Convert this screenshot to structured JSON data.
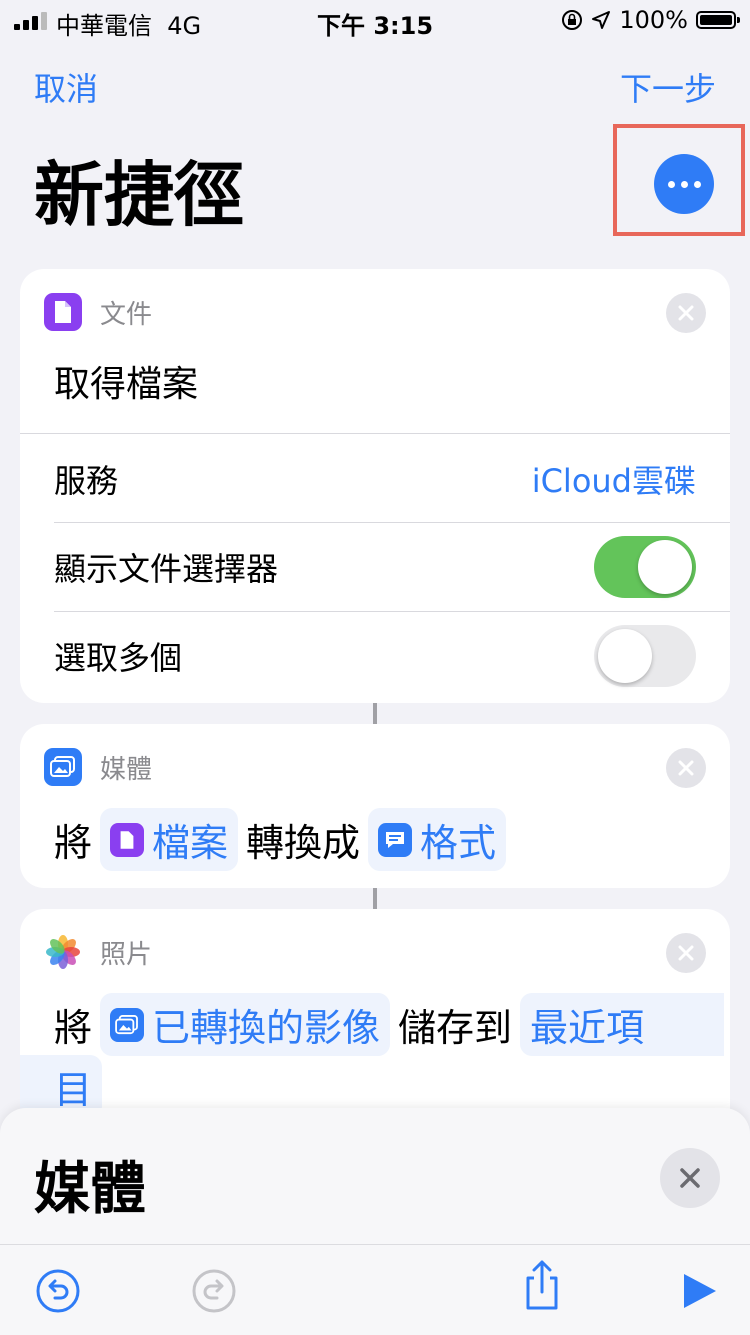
{
  "status_bar": {
    "carrier": "中華電信",
    "network": "4G",
    "time": "下午 3:15",
    "battery": "100%"
  },
  "nav": {
    "cancel": "取消",
    "next": "下一步",
    "title": "新捷徑"
  },
  "cards": {
    "get_file": {
      "category": "文件",
      "action_title": "取得檔案",
      "service_label": "服務",
      "service_value": "iCloud雲碟",
      "show_picker_label": "顯示文件選擇器",
      "show_picker_on": true,
      "select_multiple_label": "選取多個",
      "select_multiple_on": false
    },
    "convert": {
      "category": "媒體",
      "word_1": "將",
      "token_file": "檔案",
      "word_2": "轉換成",
      "token_format": "格式"
    },
    "save_photo": {
      "category": "照片",
      "word_1": "將",
      "token_image": "已轉換的影像",
      "word_2": "儲存到",
      "token_album_part1": "最近項",
      "token_album_part2": "目"
    }
  },
  "sheet": {
    "title": "媒體"
  },
  "icons": {
    "more": "ellipsis-icon",
    "document": "document-icon",
    "media": "media-icon",
    "photos": "photos-icon",
    "format": "chat-bubble-icon",
    "undo": "undo-icon",
    "redo": "redo-icon",
    "share": "share-icon",
    "run": "play-icon"
  },
  "colors": {
    "accent": "#2f7cf6",
    "toggle_on": "#63c45a",
    "document_purple": "#8a3ff0",
    "highlight": "#e8675a"
  }
}
